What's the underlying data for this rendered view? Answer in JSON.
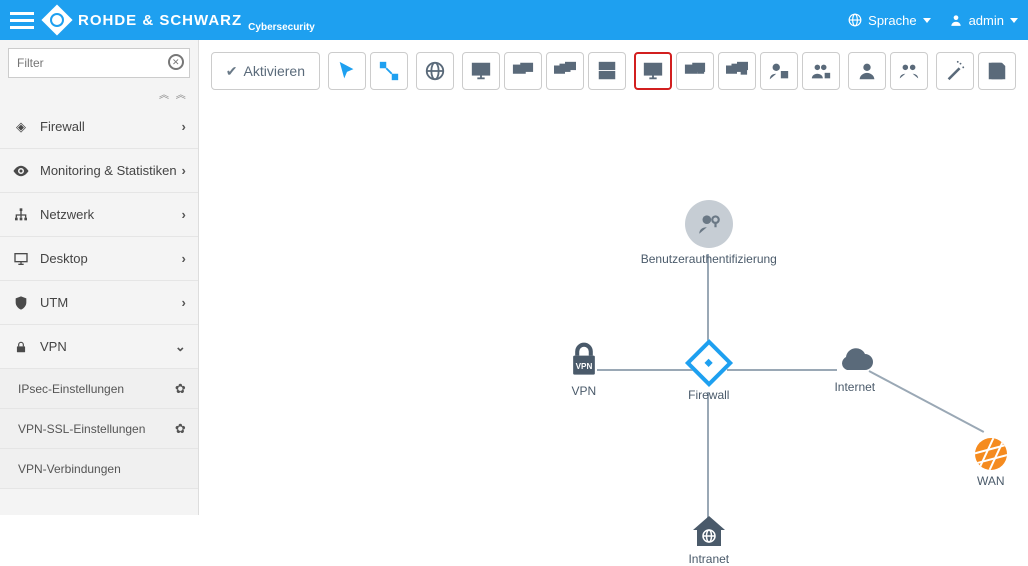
{
  "header": {
    "brand": "ROHDE & SCHWARZ",
    "brand_sub": "Cybersecurity",
    "language_label": "Sprache",
    "user_label": "admin"
  },
  "sidebar": {
    "filter_placeholder": "Filter",
    "collapse_glyph": "︽  ︽",
    "items": [
      {
        "label": "Firewall",
        "glyph": "◈",
        "expanded": false
      },
      {
        "label": "Monitoring & Statistiken",
        "glyph": "eye",
        "expanded": false
      },
      {
        "label": "Netzwerk",
        "glyph": "network",
        "expanded": false
      },
      {
        "label": "Desktop",
        "glyph": "desktop",
        "expanded": false
      },
      {
        "label": "UTM",
        "glyph": "shield",
        "expanded": false
      },
      {
        "label": "VPN",
        "glyph": "lock",
        "expanded": true
      }
    ],
    "vpn_sub": [
      {
        "label": "IPsec-Einstellungen"
      },
      {
        "label": "VPN-SSL-Einstellungen"
      },
      {
        "label": "VPN-Verbindungen"
      }
    ]
  },
  "toolbar": {
    "activate_label": "Aktivieren"
  },
  "canvas": {
    "nodes": {
      "auth": "Benutzerauthentifizierung",
      "vpn": "VPN",
      "firewall": "Firewall",
      "internet": "Internet",
      "intranet": "Intranet",
      "wan": "WAN"
    }
  }
}
